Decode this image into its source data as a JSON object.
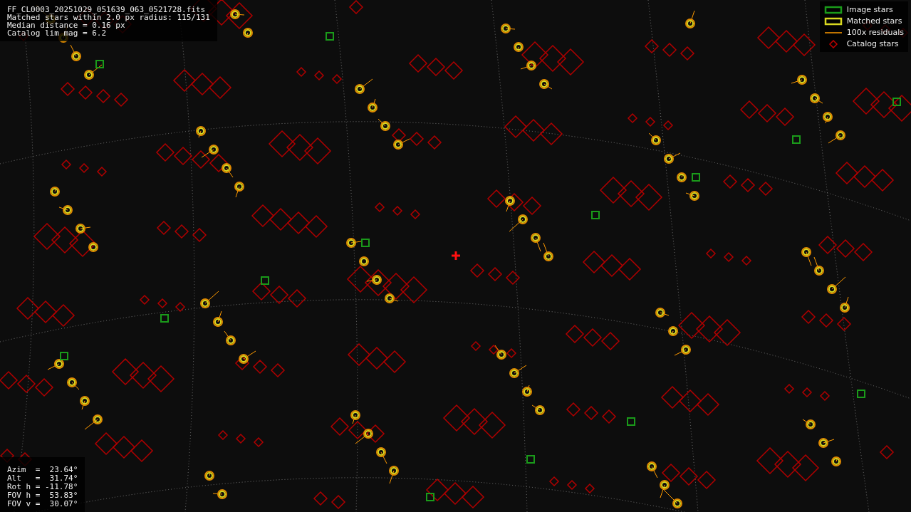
{
  "info": {
    "lines": [
      "FF_CL0003_20251029_051639_063_0521728.fits",
      "Matched stars within 2.0 px radius: 115/131",
      "Median distance = 0.16 px",
      "Catalog lim mag = 6.2"
    ]
  },
  "legend": [
    {
      "kind": "image",
      "label": "Image stars"
    },
    {
      "kind": "matched",
      "label": "Matched stars"
    },
    {
      "kind": "residual",
      "label": "100x residuals"
    },
    {
      "kind": "catalog",
      "label": "Catalog stars"
    }
  ],
  "pointing": {
    "lines": [
      "Azim  =  23.64°",
      "Alt   =  31.74°",
      "Rot h = -11.78°",
      "FOV h =  53.83°",
      "FOV v =  30.07°"
    ]
  }
}
